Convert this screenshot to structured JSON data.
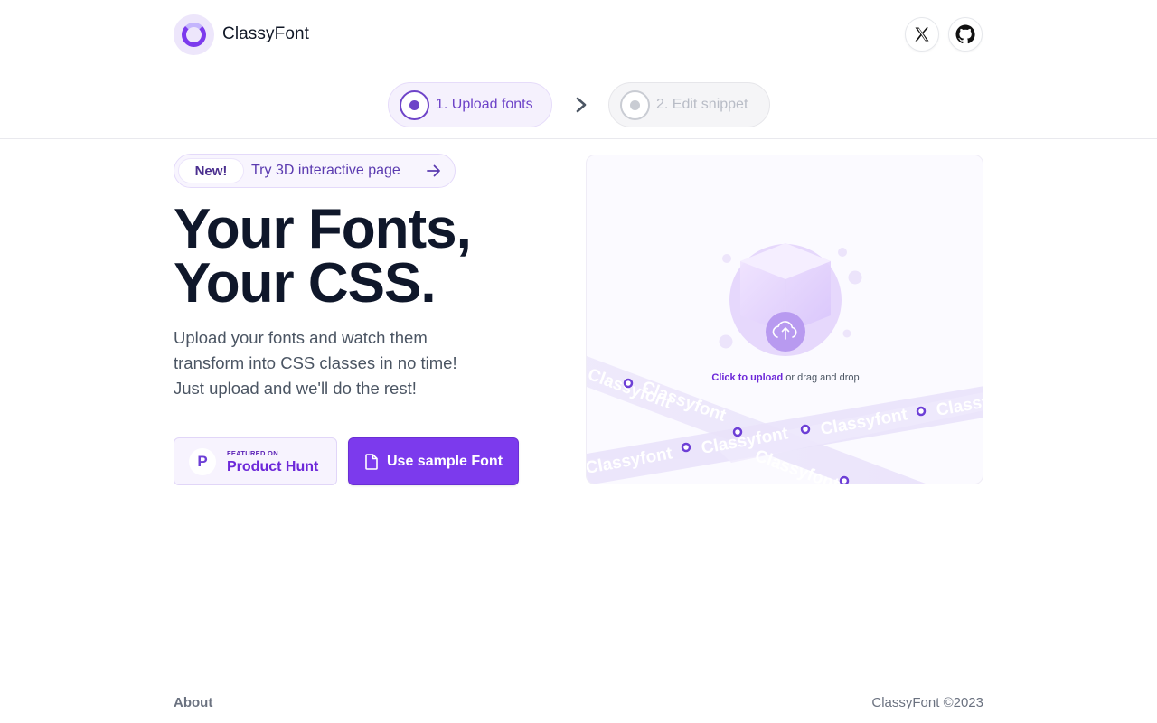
{
  "header": {
    "brand": "ClassyFont",
    "logo_icon": "loader-ring-icon",
    "social": [
      {
        "name": "x-twitter-icon"
      },
      {
        "name": "github-icon"
      }
    ]
  },
  "steps": [
    {
      "label": "1. Upload fonts",
      "state": "active"
    },
    {
      "label": "2. Edit snippet",
      "state": "inactive"
    }
  ],
  "hero": {
    "badge": "New!",
    "badge_link": "Try 3D interactive page",
    "headline_line1": "Your Fonts,",
    "headline_line2": "Your CSS.",
    "subcopy_line1": "Upload your fonts and watch them",
    "subcopy_line2": "transform into CSS classes in no time!",
    "subcopy_line3": "Just upload and we'll do the rest!",
    "product_hunt_small": "FEATURED ON",
    "product_hunt_big": "Product Hunt",
    "product_hunt_logo": "P",
    "sample_button": "Use sample Font"
  },
  "upload": {
    "link_text": "Click to upload",
    "rest_text": " or drag and drop",
    "ribbon_text": "Classyfont"
  },
  "footer": {
    "about": "About",
    "copyright": "ClassyFont ©2023"
  },
  "colors": {
    "accent": "#7c3aed",
    "accent_dark": "#6d43c8",
    "text_dark": "#0f172a",
    "muted": "#6b7280"
  }
}
